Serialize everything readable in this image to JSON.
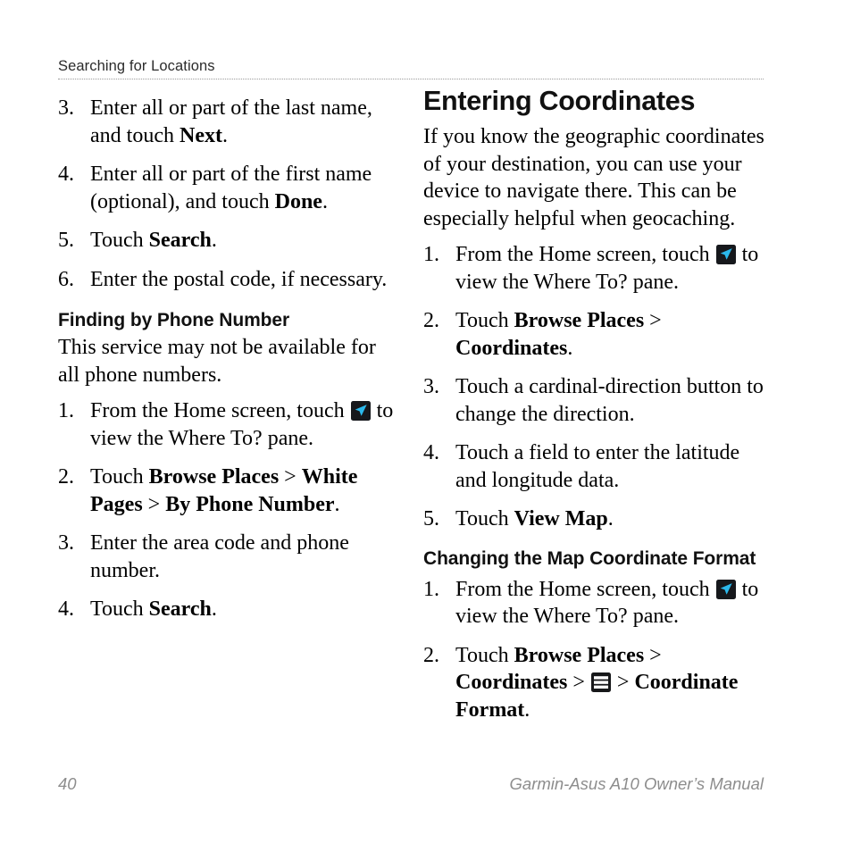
{
  "header": {
    "running_title": "Searching for Locations"
  },
  "icons": {
    "nav_arrow": {
      "name": "navigation-arrow-icon",
      "bg_color": "#16181c",
      "arrow_color": "#2cb8ec"
    },
    "menu": {
      "name": "menu-icon",
      "bg_color": "#17181a",
      "bar_color": "#ffffff"
    }
  },
  "left_column": {
    "continued_steps": [
      {
        "num": "3.",
        "parts": [
          {
            "type": "text",
            "value": "Enter all or part of the last name, and touch "
          },
          {
            "type": "bold",
            "value": "Next"
          },
          {
            "type": "text",
            "value": "."
          }
        ]
      },
      {
        "num": "4.",
        "parts": [
          {
            "type": "text",
            "value": "Enter all or part of the first name (optional), and touch "
          },
          {
            "type": "bold",
            "value": "Done"
          },
          {
            "type": "text",
            "value": "."
          }
        ]
      },
      {
        "num": "5.",
        "parts": [
          {
            "type": "text",
            "value": "Touch "
          },
          {
            "type": "bold",
            "value": "Search"
          },
          {
            "type": "text",
            "value": "."
          }
        ]
      },
      {
        "num": "6.",
        "parts": [
          {
            "type": "text",
            "value": "Enter the postal code, if necessary."
          }
        ]
      }
    ],
    "section": {
      "heading": "Finding by Phone Number",
      "intro": "This service may not be available for all phone numbers.",
      "steps": [
        {
          "num": "1.",
          "parts": [
            {
              "type": "text",
              "value": "From the Home screen, touch "
            },
            {
              "type": "icon",
              "value": "nav_arrow"
            },
            {
              "type": "text",
              "value": " to view the Where To? pane."
            }
          ]
        },
        {
          "num": "2.",
          "parts": [
            {
              "type": "text",
              "value": "Touch "
            },
            {
              "type": "bold",
              "value": "Browse Places"
            },
            {
              "type": "sep",
              "value": " > "
            },
            {
              "type": "bold",
              "value": "White Pages"
            },
            {
              "type": "sep",
              "value": " > "
            },
            {
              "type": "bold",
              "value": "By Phone Number"
            },
            {
              "type": "text",
              "value": "."
            }
          ]
        },
        {
          "num": "3.",
          "parts": [
            {
              "type": "text",
              "value": "Enter the area code and phone number."
            }
          ]
        },
        {
          "num": "4.",
          "parts": [
            {
              "type": "text",
              "value": "Touch "
            },
            {
              "type": "bold",
              "value": "Search"
            },
            {
              "type": "text",
              "value": "."
            }
          ]
        }
      ]
    }
  },
  "right_column": {
    "chapter_heading": "Entering Coordinates",
    "intro": "If you know the geographic coordinates of your destination, you can use your device to navigate there. This can be especially helpful when geocaching.",
    "steps": [
      {
        "num": "1.",
        "parts": [
          {
            "type": "text",
            "value": "From the Home screen, touch "
          },
          {
            "type": "icon",
            "value": "nav_arrow"
          },
          {
            "type": "text",
            "value": " to view the Where To? pane."
          }
        ]
      },
      {
        "num": "2.",
        "parts": [
          {
            "type": "text",
            "value": "Touch "
          },
          {
            "type": "bold",
            "value": "Browse Places"
          },
          {
            "type": "sep",
            "value": " > "
          },
          {
            "type": "bold",
            "value": "Coordinates"
          },
          {
            "type": "text",
            "value": "."
          }
        ]
      },
      {
        "num": "3.",
        "parts": [
          {
            "type": "text",
            "value": "Touch a cardinal-direction button to change the direction."
          }
        ]
      },
      {
        "num": "4.",
        "parts": [
          {
            "type": "text",
            "value": "Touch a field to enter the latitude and longitude data."
          }
        ]
      },
      {
        "num": "5.",
        "parts": [
          {
            "type": "text",
            "value": "Touch "
          },
          {
            "type": "bold",
            "value": "View Map"
          },
          {
            "type": "text",
            "value": "."
          }
        ]
      }
    ],
    "section": {
      "heading": "Changing the Map Coordinate Format",
      "steps": [
        {
          "num": "1.",
          "parts": [
            {
              "type": "text",
              "value": "From the Home screen, touch "
            },
            {
              "type": "icon",
              "value": "nav_arrow"
            },
            {
              "type": "text",
              "value": " to view the Where To? pane."
            }
          ]
        },
        {
          "num": "2.",
          "parts": [
            {
              "type": "text",
              "value": "Touch "
            },
            {
              "type": "bold",
              "value": "Browse Places"
            },
            {
              "type": "sep",
              "value": " > "
            },
            {
              "type": "bold",
              "value": "Coordinates"
            },
            {
              "type": "sep",
              "value": " > "
            },
            {
              "type": "icon",
              "value": "menu"
            },
            {
              "type": "sep",
              "value": " > "
            },
            {
              "type": "bold",
              "value": "Coordinate Format"
            },
            {
              "type": "text",
              "value": "."
            }
          ]
        }
      ]
    }
  },
  "footer": {
    "page_number": "40",
    "manual_title": "Garmin-Asus A10 Owner’s Manual"
  }
}
